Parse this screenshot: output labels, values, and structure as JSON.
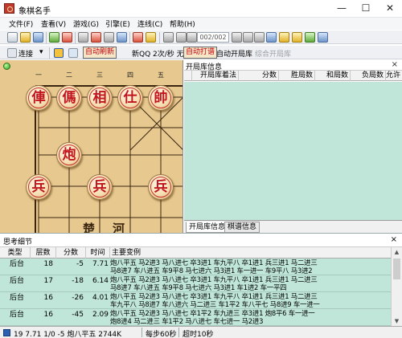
{
  "window": {
    "title": "象棋名手",
    "minimize": "—",
    "maximize": "☐",
    "close": "✕"
  },
  "menu": [
    "文件(F)",
    "查看(V)",
    "游戏(G)",
    "引擎(E)",
    "连线(C)",
    "帮助(H)"
  ],
  "toolbar1": {
    "page_indicator": "002/002"
  },
  "toolbar2": {
    "connect": "连接",
    "auto_refresh": "自动刷新",
    "speed": "新QQ 2次/秒 无",
    "auto_play": "自动打谱",
    "auto_book": "自动开局库",
    "composite_book": "综合开局库"
  },
  "board": {
    "file_labels": [
      "一",
      "二",
      "三",
      "四",
      "五"
    ],
    "top_row": [
      "俥",
      "傌",
      "相",
      "仕",
      "帥"
    ],
    "cannon": "炮",
    "soldiers": [
      "兵",
      "兵",
      "兵"
    ],
    "river_text": [
      "楚",
      "河"
    ]
  },
  "book_panel": {
    "title": "开局库信息",
    "close": "×",
    "columns": [
      "开局库着法",
      "分数",
      "胜局数",
      "和局数",
      "负局数",
      "允许"
    ],
    "tabs": [
      "开局库信息",
      "棋谱信息"
    ]
  },
  "think_panel": {
    "title": "思考细节",
    "close": "×",
    "columns": [
      "类型",
      "层数",
      "分数",
      "时间",
      "主要变例"
    ],
    "rows": [
      {
        "type": "后台",
        "depth": "18",
        "score": "-5",
        "time": "7.71",
        "line1": "炮八平五 马2进3 马八进七 卒3进1 车九平八 卒1进1 兵三进1 马二进三",
        "line2": "马8进7 车八进五 车9平8 马七进六 马3进1 车一进一 车9平八 马3进2"
      },
      {
        "type": "后台",
        "depth": "17",
        "score": "-18",
        "time": "6.14",
        "line1": "炮八平五 马2进3 马八进七 卒3进1 车九平八 卒1进1 兵三进1 马二进三",
        "line2": "马8进7 车八进五 车9平8 马七进六 马3进1 车1进2 车一平四"
      },
      {
        "type": "后台",
        "depth": "16",
        "score": "-26",
        "time": "4.01",
        "line1": "炮八平五 马2进3 马八进七 卒3进1 车九平八 卒1进1 兵三进1 马二进三",
        "line2": "车九平八 马8进7 车八进六 马二进三 车1平2 车八平七 马8进9 车一进一"
      },
      {
        "type": "后台",
        "depth": "16",
        "score": "-45",
        "time": "2.09",
        "line1": "炮八平五 马2进3 马八进七 卒1平2 车九进三 卒3进1 炮8平6 车一进一",
        "line2": "炮8进4 马二进三 车1平2 马八进七 车七进一 马2进3"
      }
    ]
  },
  "status": {
    "info": "19 7.71 1/0 -5 炮八平五 2744K",
    "per_move": "每步60秒",
    "timeout": "超时10秒"
  }
}
